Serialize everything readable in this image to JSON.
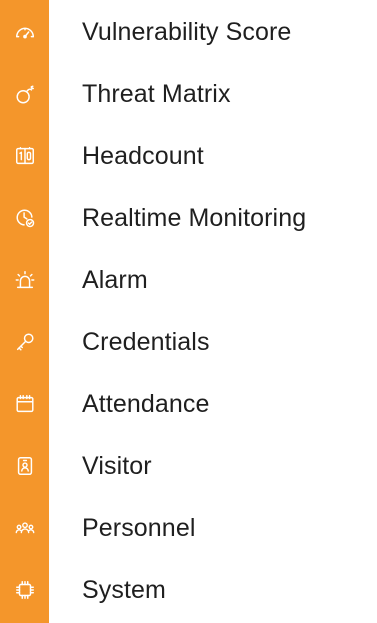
{
  "sidebar": {
    "accent": "#F4962B",
    "items": [
      {
        "label": "Vulnerability Score",
        "icon": "gauge-icon"
      },
      {
        "label": "Threat Matrix",
        "icon": "bomb-icon"
      },
      {
        "label": "Headcount",
        "icon": "counter-icon"
      },
      {
        "label": "Realtime Monitoring",
        "icon": "clock-check-icon"
      },
      {
        "label": "Alarm",
        "icon": "siren-icon"
      },
      {
        "label": "Credentials",
        "icon": "key-icon"
      },
      {
        "label": "Attendance",
        "icon": "calendar-icon"
      },
      {
        "label": "Visitor",
        "icon": "badge-icon"
      },
      {
        "label": "Personnel",
        "icon": "users-icon"
      },
      {
        "label": "System",
        "icon": "chip-icon"
      }
    ]
  }
}
